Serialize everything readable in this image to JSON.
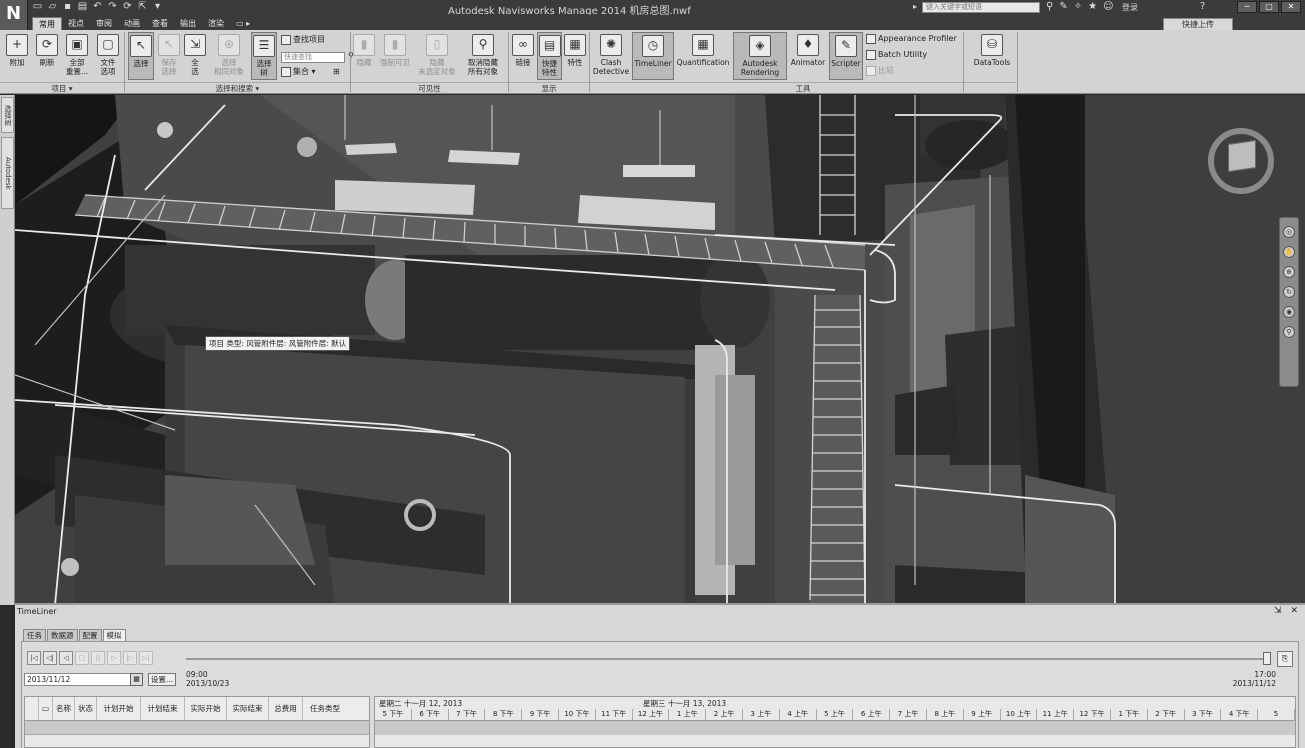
{
  "window": {
    "title": "Autodesk Navisworks Manage 2014    机房总图.nwf",
    "search_placeholder": "键入关键字或短语",
    "login_label": "登录",
    "share_label": "快捷上传",
    "controls": [
      "─",
      "▢",
      "✕"
    ]
  },
  "ribbon_tabs": [
    "常用",
    "视点",
    "审阅",
    "动画",
    "查看",
    "输出",
    "渲染",
    "▭ ▸"
  ],
  "ribbon": {
    "project": {
      "label": "项目 ▾",
      "buttons": [
        "附加",
        "刷新",
        "全部\n重置...",
        "文件\n选项"
      ]
    },
    "select": {
      "label": "选择和搜索 ▾",
      "buttons": [
        "选择",
        "保存\n选择",
        "全\n选",
        "选择\n相同对象",
        "选择\n树"
      ],
      "small": [
        "查找项目",
        "快速查找",
        "集合 ▾"
      ],
      "input_placeholder": "快速查找"
    },
    "visibility": {
      "label": "可见性",
      "buttons": [
        "隐藏",
        "强制可见",
        "隐藏\n未选定对象",
        "取消隐藏\n所有对象"
      ]
    },
    "display": {
      "label": "显示",
      "buttons": [
        "链接",
        "快捷\n特性",
        "特性"
      ]
    },
    "tools": {
      "label": "工具",
      "buttons": [
        "Clash\nDetective",
        "TimeLiner",
        "Quantification",
        "Autodesk\nRendering",
        "Animator",
        "Scripter"
      ],
      "small": [
        "Appearance Profiler",
        "Batch Utility",
        "比较"
      ]
    },
    "datatools": "DataTools"
  },
  "left_dock_tabs": [
    "选择树",
    "Autodesk Rendering"
  ],
  "viewport": {
    "tooltip": "项目 类型: 风管附件层: 风管附件层: 默认"
  },
  "timeliner": {
    "title": "TimeLiner",
    "panel_controls": "⇲ ✕",
    "tabs": [
      "任务",
      "数据源",
      "配置",
      "模拟"
    ],
    "active_tab": "模拟",
    "date_value": "2013/11/12",
    "settings_label": "设置...",
    "start_time": "09:00",
    "start_date": "2013/10/23",
    "end_time": "17:00",
    "end_date": "2013/11/12",
    "columns": [
      "",
      "",
      "名称",
      "状态",
      "计划开始",
      "计划结束",
      "实际开始",
      "实际结束",
      "总费用",
      "任务类型"
    ],
    "day_headers": [
      "星期二 十一月 12, 2013",
      "星期三 十一月 13, 2013"
    ],
    "hours": [
      "5 下午",
      "6 下午",
      "7 下午",
      "8 下午",
      "9 下午",
      "10 下午",
      "11 下午",
      "12 上午",
      "1 上午",
      "2 上午",
      "3 上午",
      "4 上午",
      "5 上午",
      "6 上午",
      "7 上午",
      "8 上午",
      "9 上午",
      "10 上午",
      "11 上午",
      "12 下午",
      "1 下午",
      "2 下午",
      "3 下午",
      "4 下午",
      "5"
    ]
  },
  "colors": {
    "titlebar": "#3b3b3b",
    "ribbon": "#d3d3d3",
    "viewport": "#3c3c3c",
    "panel": "#d7d7d7"
  }
}
